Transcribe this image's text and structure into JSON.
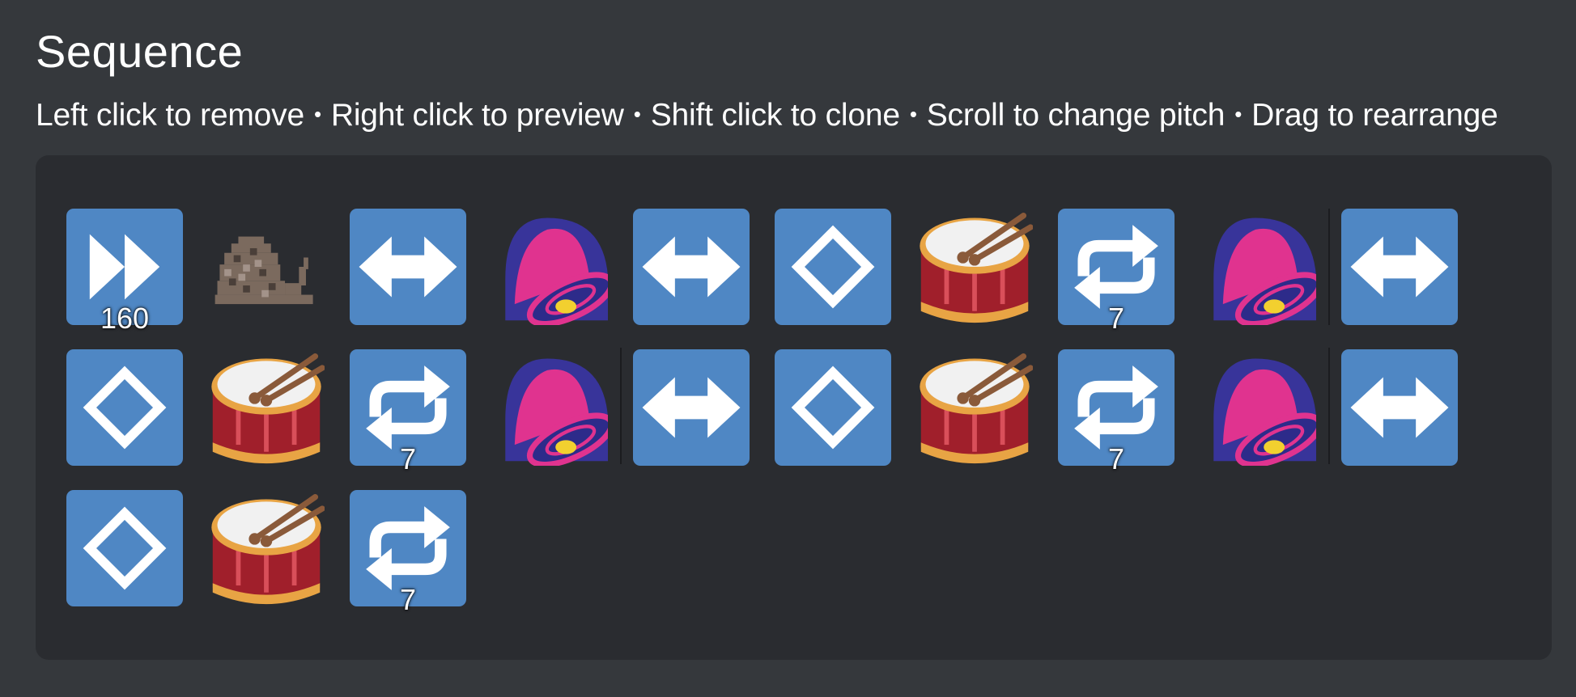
{
  "header": {
    "title": "Sequence",
    "instructions": [
      "Left click to remove",
      "Right click to preview",
      "Shift click to clone",
      "Scroll to change pitch",
      "Drag to rearrange"
    ],
    "separator": "•"
  },
  "colors": {
    "background": "#35383c",
    "panel": "#2a2c30",
    "tile_blue": "#4f87c4",
    "bell": "#e0338f",
    "drum": "#a01f2b"
  },
  "sequence": [
    {
      "icon": "fast-forward-icon",
      "label": "160"
    },
    {
      "icon": "snail-sprite-icon"
    },
    {
      "icon": "left-right-arrow-icon"
    },
    {
      "icon": "bell-icon"
    },
    {
      "icon": "left-right-arrow-icon"
    },
    {
      "icon": "diamond-icon"
    },
    {
      "icon": "drum-icon"
    },
    {
      "icon": "repeat-icon",
      "label": "7"
    },
    {
      "icon": "bell-icon"
    },
    {
      "icon": "left-right-arrow-icon"
    },
    {
      "icon": "diamond-icon"
    },
    {
      "icon": "drum-icon"
    },
    {
      "icon": "repeat-icon",
      "label": "7"
    },
    {
      "icon": "bell-icon"
    },
    {
      "icon": "left-right-arrow-icon"
    },
    {
      "icon": "diamond-icon"
    },
    {
      "icon": "drum-icon"
    },
    {
      "icon": "repeat-icon",
      "label": "7"
    },
    {
      "icon": "bell-icon"
    },
    {
      "icon": "left-right-arrow-icon"
    },
    {
      "icon": "diamond-icon"
    },
    {
      "icon": "drum-icon"
    },
    {
      "icon": "repeat-icon",
      "label": "7"
    }
  ]
}
